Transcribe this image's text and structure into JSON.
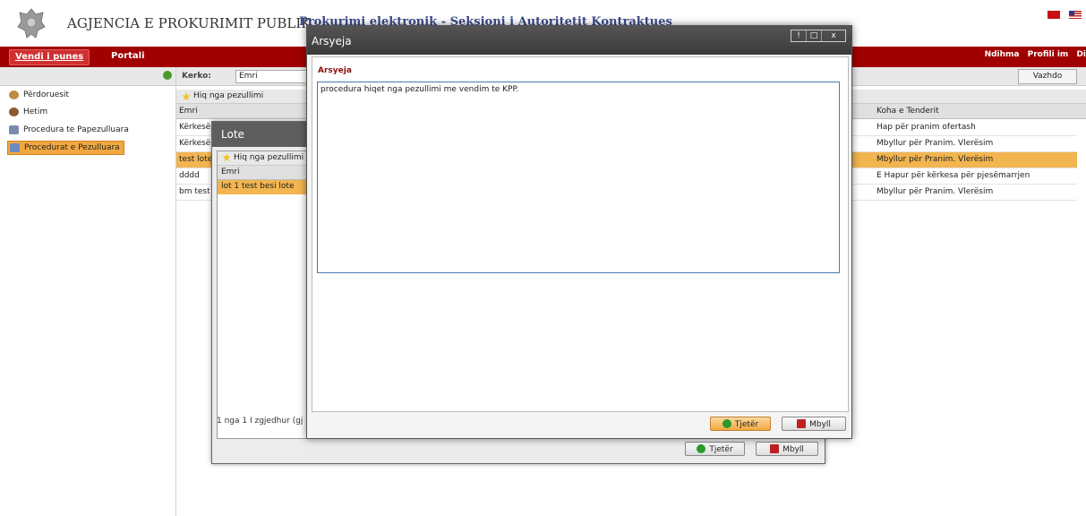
{
  "header": {
    "agency": "AGJENCIA E PROKURIMIT PUBLIK",
    "subtitle": "Prokurimi elektronik - Seksioni i Autoritetit Kontraktues"
  },
  "nav": {
    "tabs": [
      "Vendi i punes",
      "Portali"
    ],
    "right_links": [
      "Ndihma",
      "Profili im",
      "Di"
    ]
  },
  "sidebar": {
    "items": [
      {
        "label": "Përdoruesit",
        "icon": "users-icon"
      },
      {
        "label": "Hetim",
        "icon": "investigation-icon"
      },
      {
        "label": "Procedura te Papezulluara",
        "icon": "table-icon"
      },
      {
        "label": "Procedurat e Pezulluara",
        "icon": "table-icon"
      }
    ]
  },
  "search": {
    "label": "Kerko:",
    "field": "Emri",
    "button": "Vazhdo"
  },
  "grid": {
    "toolbar_action": "Hiq nga pezullimi",
    "col_name": "Emri",
    "col_time": "Koha e Tenderit",
    "rows": [
      {
        "name": "Kërkesë",
        "time": "Hap për pranim ofertash"
      },
      {
        "name": "Kërkesë",
        "time": "Mbyllur për Pranim. Vlerësim"
      },
      {
        "name": "test lote",
        "time": "Mbyllur për Pranim. Vlerësim"
      },
      {
        "name": "dddd",
        "time": "E Hapur për kërkesa për pjesëmarrjen"
      },
      {
        "name": "bm test",
        "time": "Mbyllur për Pranim. Vlerësim"
      }
    ]
  },
  "lote": {
    "title": "Lote",
    "toolbar_action": "Hiq nga pezullimi",
    "col_name": "Emri",
    "row": "lot 1 test besi lote",
    "status": "1 nga 1 I zgjedhur (gj",
    "next": "Tjetër",
    "close": "Mbyll"
  },
  "arsyeja": {
    "title": "Arsyeja",
    "controls": [
      "!",
      "□",
      "x"
    ],
    "label": "Arsyeja",
    "text": "procedura hiqet nga pezullimi me vendim te KPP.",
    "next": "Tjetër",
    "close": "Mbyll"
  },
  "colors": {
    "red_bar": "#a00000",
    "selected_row": "#f2b550",
    "dialog_title": "#3a3a3a"
  }
}
